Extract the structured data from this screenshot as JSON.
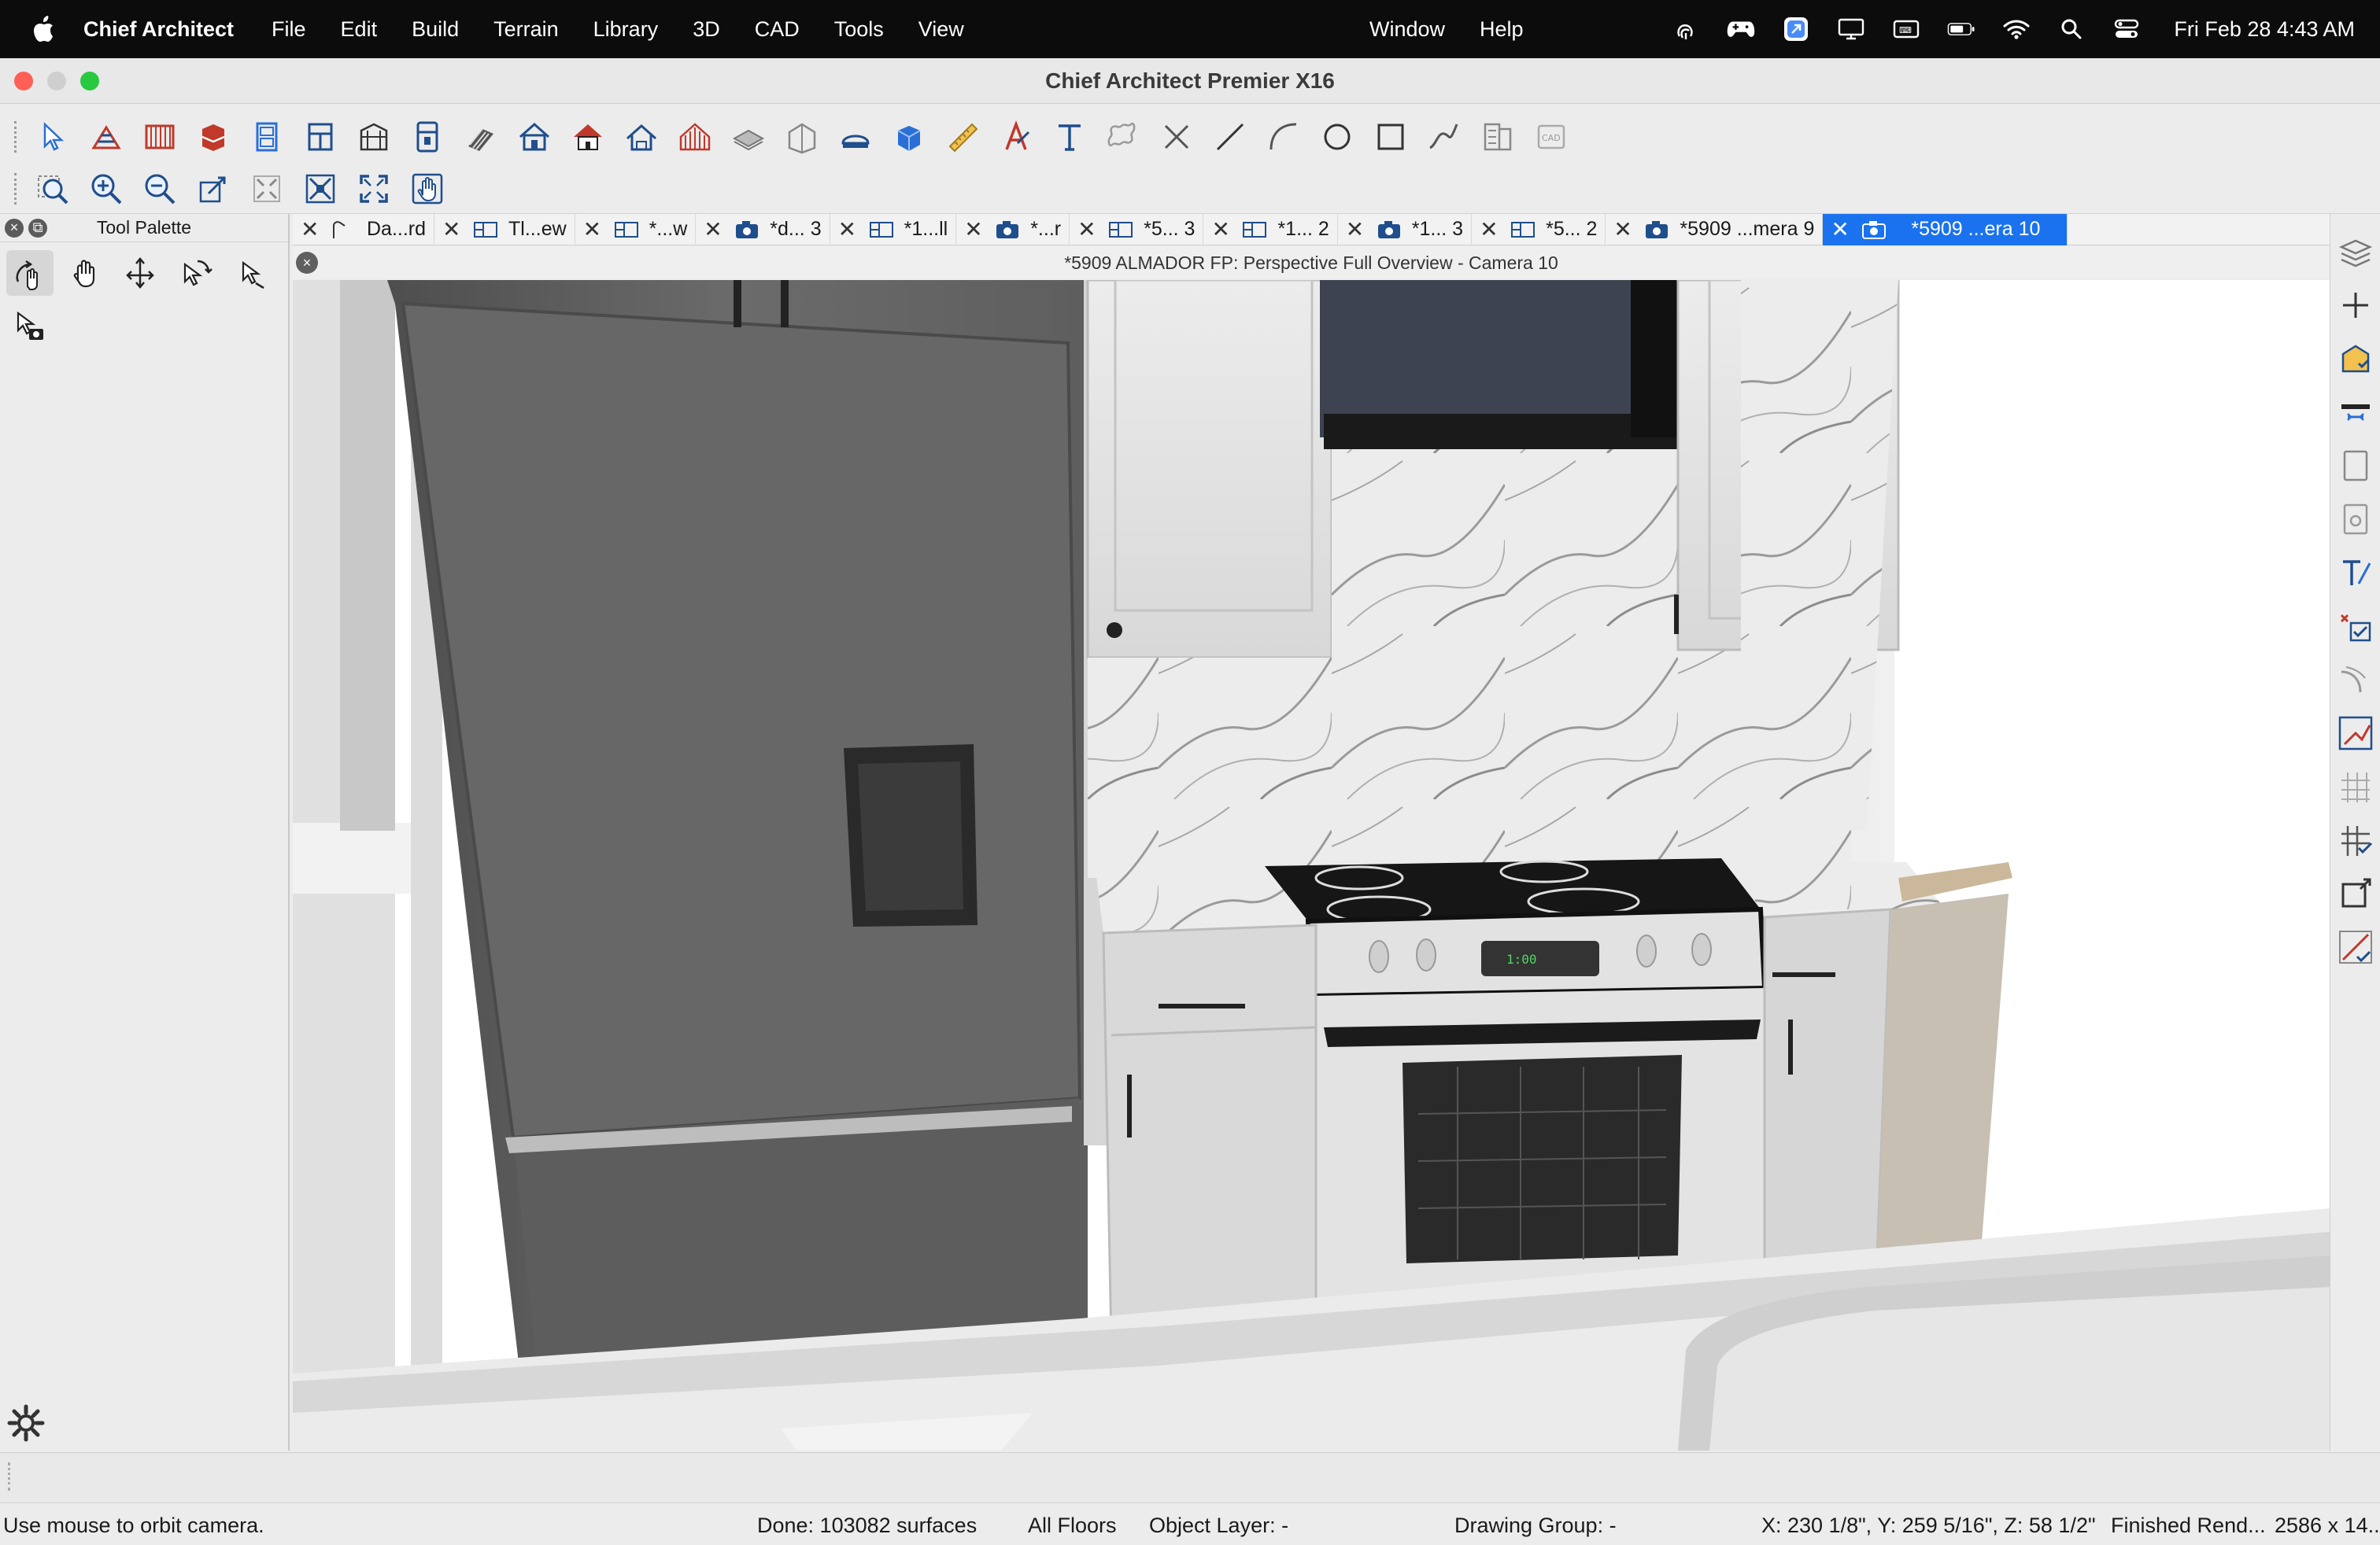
{
  "menubar": {
    "app_name": "Chief Architect",
    "menus": [
      "File",
      "Edit",
      "Build",
      "Terrain",
      "Library",
      "3D",
      "CAD",
      "Tools",
      "View"
    ],
    "right_menus": [
      "Window",
      "Help"
    ],
    "status_icons": [
      "touch-id-icon",
      "gamepad-icon",
      "browser-icon",
      "display-icon",
      "keyboard-icon",
      "battery-icon",
      "wifi-icon",
      "spotlight-icon",
      "control-center-icon"
    ],
    "clock": "Fri Feb 28  4:43 AM"
  },
  "window": {
    "title": "Chief Architect Premier X16"
  },
  "toolbar1": {
    "icons": [
      "select-objects-icon",
      "wall-tools-icon",
      "railing-icon",
      "cabinet-icon",
      "door-icon",
      "window-icon",
      "shelf-icon",
      "appliance-icon",
      "stairs-icon",
      "build-house-icon",
      "roof-icon",
      "dormer-icon",
      "framing-icon",
      "slab-icon",
      "room-icon",
      "ceiling-icon",
      "material-box-icon",
      "dimension-icon",
      "text-style-icon",
      "text-icon",
      "callout-icon",
      "delete-x-icon",
      "line-icon",
      "arc-icon",
      "circle-icon",
      "rectangle-icon",
      "spline-icon",
      "layout-icon",
      "cad-block-icon"
    ]
  },
  "toolbar2": {
    "icons": [
      "zoom-icon",
      "zoom-in-icon",
      "zoom-out-icon",
      "undo-zoom-icon",
      "fill-window-icon",
      "fill-window-building-icon",
      "full-screen-icon",
      "pan-icon"
    ]
  },
  "palette": {
    "title": "Tool Palette",
    "tools": [
      "orbit-camera-icon",
      "hand-pan-icon",
      "move-camera-icon",
      "rotate-camera-icon",
      "mouse-orbit-icon",
      "camera-select-icon"
    ]
  },
  "tabs": [
    {
      "label": "Da...rd",
      "icon": "elevation-icon"
    },
    {
      "label": "Tl...ew",
      "icon": "floorplan-icon"
    },
    {
      "label": "*...w",
      "icon": "floorplan-icon"
    },
    {
      "label": "*d... 3",
      "icon": "camera-icon"
    },
    {
      "label": "*1...ll",
      "icon": "floorplan-icon"
    },
    {
      "label": "*...r",
      "icon": "camera-icon"
    },
    {
      "label": "*5... 3",
      "icon": "floorplan-icon"
    },
    {
      "label": "*1... 2",
      "icon": "floorplan-icon"
    },
    {
      "label": "*1... 3",
      "icon": "camera-icon"
    },
    {
      "label": "*5... 2",
      "icon": "floorplan-icon"
    },
    {
      "label": "*5909 ...mera 9",
      "icon": "camera-icon"
    },
    {
      "label": "*5909 ...era 10",
      "icon": "camera-icon",
      "active": true
    }
  ],
  "view": {
    "title": "*5909 ALMADOR FP: Perspective Full Overview - Camera 10",
    "oven_clock": "1:00"
  },
  "rightbar": {
    "icons": [
      "layers-icon",
      "add-icon",
      "layer-display-icon",
      "toggle-icon",
      "page-icon",
      "preview-icon",
      "text-check-icon",
      "check-list-icon",
      "curve-icon",
      "axis-icon",
      "grid-icon",
      "snap-grid-icon",
      "bound-box-icon",
      "ruler-check-icon"
    ]
  },
  "status": {
    "hint": "Use mouse to orbit camera.",
    "done": "Done:  103082 surfaces",
    "floors": "All Floors",
    "object_layer": "Object Layer: -",
    "drawing_group": "Drawing Group: -",
    "coords": "X: 230 1/8\", Y: 259 5/16\", Z: 58 1/2\"",
    "render": "Finished Rend...",
    "size": "2586 x 14..."
  },
  "colors": {
    "accent_tab": "#1a72ee",
    "menubar_bg": "#0c0c0c",
    "close_light": "#ff5f57",
    "min_light": "#cfcfcf",
    "max_light": "#28c840"
  }
}
